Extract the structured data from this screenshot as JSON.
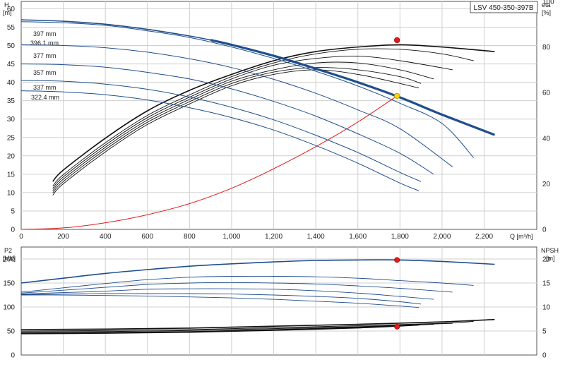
{
  "model_label": "LSV 450-350-397B",
  "colors": {
    "blue": "#1f4e8c",
    "black": "#111111",
    "red": "#e31b1b",
    "yellow": "#ffd400",
    "grid": "#cfcfcf",
    "axis": "#555555"
  },
  "chart_data": [
    {
      "type": "line",
      "panel": "top",
      "left_axis": {
        "label_top": "H",
        "label_unit": "[m]",
        "ticks": [
          0,
          5,
          10,
          15,
          20,
          25,
          30,
          35,
          40,
          45,
          50,
          55,
          60
        ],
        "ylim": [
          0,
          62
        ]
      },
      "right_axis": {
        "label_top": "eta",
        "label_unit": "[%]",
        "ticks": [
          0,
          20,
          40,
          60,
          80,
          100
        ],
        "ylim": [
          0,
          100
        ]
      },
      "x_axis": {
        "label": "Q [m³/h]",
        "ticks": [
          0,
          200,
          400,
          600,
          800,
          1000,
          1200,
          1400,
          1600,
          1800,
          2000,
          2200
        ],
        "tick_labels": [
          "0",
          "200",
          "400",
          "600",
          "800",
          "1,000",
          "1,200",
          "1,400",
          "1,600",
          "1,800",
          "2,000",
          "2,200"
        ],
        "xlim": [
          0,
          2450
        ]
      },
      "grid": true,
      "head_curves": [
        {
          "name": "397 mm",
          "bold": true,
          "x": [
            0,
            200,
            400,
            600,
            800,
            900,
            1000,
            1200,
            1400,
            1600,
            1800,
            2000,
            2250
          ],
          "y": [
            57,
            56.6,
            55.8,
            54.4,
            52.6,
            51.5,
            50.2,
            47.2,
            43.7,
            40,
            35.9,
            31.2,
            25.7
          ]
        },
        {
          "name": "396.1 mm",
          "bold": false,
          "x": [
            0,
            200,
            400,
            600,
            800,
            1000,
            1200,
            1400,
            1600,
            1800,
            2000,
            2150
          ],
          "y": [
            56.5,
            56.2,
            55.5,
            54,
            52.2,
            49.6,
            46.5,
            43,
            39,
            34.3,
            28.8,
            19.5
          ]
        },
        {
          "name": "377 mm",
          "bold": false,
          "x": [
            0,
            200,
            400,
            600,
            800,
            1000,
            1200,
            1400,
            1600,
            1800,
            2050
          ],
          "y": [
            50.2,
            50,
            49.4,
            48.2,
            46.4,
            44,
            40.8,
            37,
            32.5,
            27.4,
            17
          ]
        },
        {
          "name": "357 mm",
          "bold": false,
          "x": [
            0,
            200,
            400,
            600,
            800,
            1000,
            1200,
            1400,
            1600,
            1800,
            1960
          ],
          "y": [
            45,
            44.8,
            44.1,
            42.7,
            40.9,
            38.2,
            34.8,
            30.8,
            26,
            20.7,
            15
          ]
        },
        {
          "name": "337 mm",
          "bold": false,
          "x": [
            0,
            200,
            400,
            600,
            800,
            1000,
            1200,
            1400,
            1600,
            1800,
            1900
          ],
          "y": [
            40.5,
            40.3,
            39.5,
            38.1,
            36,
            33.2,
            29.8,
            25.6,
            20.9,
            15.5,
            13
          ]
        },
        {
          "name": "322.4 mm",
          "bold": false,
          "x": [
            0,
            200,
            400,
            600,
            800,
            1000,
            1200,
            1400,
            1600,
            1800,
            1890
          ],
          "y": [
            37.7,
            37.4,
            36.6,
            35.2,
            33.1,
            30.4,
            27,
            22.8,
            18,
            12.6,
            10.5
          ]
        }
      ],
      "efficiency_curves": [
        {
          "x": [
            150,
            200,
            400,
            600,
            800,
            1000,
            1200,
            1400,
            1600,
            1800,
            2000,
            2250
          ],
          "y": [
            21,
            26,
            40,
            52,
            61,
            68,
            74,
            78,
            80,
            81,
            80,
            78
          ]
        },
        {
          "x": [
            150,
            200,
            400,
            600,
            800,
            1000,
            1200,
            1400,
            1600,
            1800,
            2000,
            2150
          ],
          "y": [
            19,
            24,
            38,
            50,
            59,
            67,
            73,
            77,
            79,
            79,
            77,
            74
          ]
        },
        {
          "x": [
            150,
            200,
            400,
            600,
            800,
            1000,
            1200,
            1400,
            1600,
            1800,
            2050
          ],
          "y": [
            18,
            23,
            37,
            49,
            58,
            66,
            72,
            75,
            76,
            74,
            70
          ]
        },
        {
          "x": [
            150,
            200,
            400,
            600,
            800,
            1000,
            1200,
            1400,
            1600,
            1800,
            1960
          ],
          "y": [
            17,
            22,
            36,
            48,
            57,
            65,
            70,
            73,
            73,
            70,
            66
          ]
        },
        {
          "x": [
            150,
            200,
            400,
            600,
            800,
            1000,
            1200,
            1400,
            1600,
            1800,
            1900
          ],
          "y": [
            16,
            21,
            35,
            47,
            56,
            64,
            69,
            71,
            70,
            67,
            64
          ]
        },
        {
          "x": [
            150,
            200,
            400,
            600,
            800,
            1000,
            1200,
            1400,
            1600,
            1800,
            1890
          ],
          "y": [
            15,
            20,
            34,
            46,
            55,
            63,
            68,
            70,
            68,
            64,
            62
          ]
        }
      ],
      "system_curve": {
        "x": [
          0,
          200,
          400,
          600,
          800,
          1000,
          1200,
          1400,
          1600,
          1786
        ],
        "y": [
          0,
          0.4,
          1.8,
          4,
          7,
          11.2,
          16.5,
          22.5,
          29.2,
          36.3
        ]
      },
      "duty_points": [
        {
          "x": 1786,
          "y": 36.3,
          "axis": "left",
          "color": "yellow"
        },
        {
          "x": 1786,
          "y": 83,
          "axis": "right",
          "color": "red"
        }
      ]
    },
    {
      "type": "line",
      "panel": "bottom",
      "left_axis": {
        "label_top": "P2",
        "label_unit": "[kW]",
        "ticks": [
          0,
          50,
          100,
          150,
          200
        ],
        "ylim": [
          0,
          225
        ]
      },
      "right_axis": {
        "label_top": "NPSH",
        "label_unit": "[m]",
        "ticks": [
          0,
          5,
          10,
          15,
          20
        ],
        "ylim": [
          0,
          22.5
        ]
      },
      "x_axis": {
        "xlim": [
          0,
          2450
        ]
      },
      "grid": true,
      "power_curves": [
        {
          "x": [
            0,
            200,
            400,
            600,
            800,
            1000,
            1200,
            1400,
            1600,
            1800,
            2000,
            2250
          ],
          "y": [
            150,
            160,
            170,
            178,
            185,
            190,
            194,
            197,
            198,
            198,
            195,
            189
          ]
        },
        {
          "x": [
            0,
            200,
            400,
            600,
            800,
            1000,
            1200,
            1400,
            1600,
            1800,
            2000,
            2150
          ],
          "y": [
            131,
            140,
            149,
            157,
            162,
            164,
            164,
            163,
            160,
            155,
            150,
            145
          ]
        },
        {
          "x": [
            0,
            200,
            400,
            600,
            800,
            1000,
            1200,
            1400,
            1600,
            1800,
            2050
          ],
          "y": [
            129,
            135,
            141,
            147,
            150,
            151,
            150,
            148,
            144,
            139,
            131
          ]
        },
        {
          "x": [
            0,
            200,
            400,
            600,
            800,
            1000,
            1200,
            1400,
            1600,
            1800,
            1960
          ],
          "y": [
            127,
            130,
            133,
            137,
            138,
            138,
            137,
            134,
            129,
            122,
            116
          ]
        },
        {
          "x": [
            0,
            200,
            400,
            600,
            800,
            1000,
            1200,
            1400,
            1600,
            1800,
            1900
          ],
          "y": [
            126,
            127,
            128,
            128,
            128,
            127,
            125,
            122,
            118,
            111,
            106
          ]
        },
        {
          "x": [
            0,
            200,
            400,
            600,
            800,
            1000,
            1200,
            1400,
            1600,
            1800,
            1890
          ],
          "y": [
            125,
            125,
            124,
            123,
            121,
            119,
            116,
            112,
            108,
            102,
            99
          ]
        }
      ],
      "npsh_curves": [
        {
          "x": [
            0,
            400,
            800,
            1200,
            1600,
            2000,
            2250
          ],
          "y": [
            5.3,
            5.4,
            5.6,
            6,
            6.4,
            6.9,
            7.4
          ]
        },
        {
          "x": [
            0,
            400,
            800,
            1200,
            1600,
            2000,
            2150
          ],
          "y": [
            5.0,
            5.1,
            5.3,
            5.7,
            6.1,
            6.6,
            7.0
          ]
        },
        {
          "x": [
            0,
            400,
            800,
            1200,
            1600,
            2050
          ],
          "y": [
            4.8,
            4.9,
            5.1,
            5.5,
            5.9,
            6.6
          ]
        },
        {
          "x": [
            0,
            400,
            800,
            1200,
            1600,
            1960
          ],
          "y": [
            4.6,
            4.7,
            4.9,
            5.3,
            5.8,
            6.4
          ]
        },
        {
          "x": [
            0,
            400,
            800,
            1200,
            1600,
            1900
          ],
          "y": [
            4.5,
            4.6,
            4.8,
            5.2,
            5.7,
            6.3
          ]
        },
        {
          "x": [
            0,
            400,
            800,
            1200,
            1600,
            1890
          ],
          "y": [
            4.4,
            4.5,
            4.7,
            5.1,
            5.6,
            6.2
          ]
        }
      ],
      "duty_points": [
        {
          "x": 1786,
          "y": 198,
          "axis": "left",
          "color": "red"
        },
        {
          "x": 1786,
          "y": 5.9,
          "axis": "right",
          "color": "red"
        }
      ]
    }
  ]
}
